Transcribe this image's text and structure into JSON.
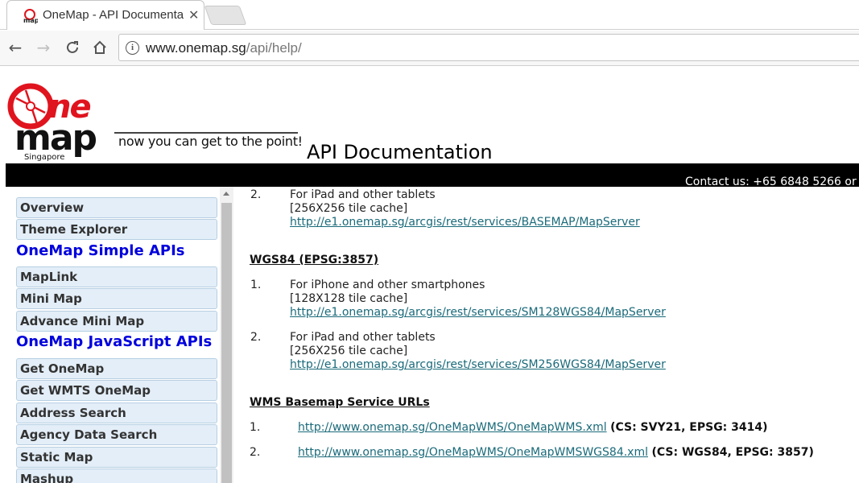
{
  "browser": {
    "tab_title": "OneMap - API Documentation",
    "url_host": "www.onemap.sg",
    "url_path": "/api/help/"
  },
  "header": {
    "logo_text": "One map",
    "logo_sub": "Singapore",
    "tagline": "now you can get to the point!",
    "title": "API Documentation",
    "contact": "Contact us: +65 6848 5266 or"
  },
  "sidebar": {
    "items_a": [
      "Overview",
      "Theme Explorer"
    ],
    "head_simple": "OneMap Simple APIs",
    "items_b": [
      "MapLink",
      "Mini Map",
      "Advance Mini Map"
    ],
    "head_js": "OneMap JavaScript APIs",
    "items_c": [
      "Get OneMap",
      "Get WMTS OneMap",
      "Address Search",
      "Agency Data Search",
      "Static Map",
      "Mashup"
    ]
  },
  "content": {
    "top_item": {
      "num": "2.",
      "device": "For iPad and other tablets",
      "cache": "[256X256 tile cache]",
      "url": "http://e1.onemap.sg/arcgis/rest/services/BASEMAP/MapServer"
    },
    "wgs_heading": "WGS84 (EPSG:3857)",
    "wgs_items": [
      {
        "num": "1.",
        "device": "For iPhone and other smartphones",
        "cache": "[128X128 tile cache]",
        "url": "http://e1.onemap.sg/arcgis/rest/services/SM128WGS84/MapServer"
      },
      {
        "num": "2.",
        "device": "For iPad and other tablets",
        "cache": "[256X256 tile cache]",
        "url": "http://e1.onemap.sg/arcgis/rest/services/SM256WGS84/MapServer"
      }
    ],
    "wms_heading": "WMS Basemap Service URLs",
    "wms_items": [
      {
        "num": "1.",
        "url": "http://www.onemap.sg/OneMapWMS/OneMapWMS.xml",
        "cs": "(CS: SVY21, EPSG: 3414)"
      },
      {
        "num": "2.",
        "url": "http://www.onemap.sg/OneMapWMS/OneMapWMSWGS84.xml",
        "cs": "(CS: WGS84, EPSG: 3857)"
      }
    ]
  },
  "colors": {
    "link": "#1a6a7a",
    "sidebar_heading": "#0000dd",
    "sidebar_item_bg": "#e3eef8",
    "logo_red": "#e0141e"
  }
}
